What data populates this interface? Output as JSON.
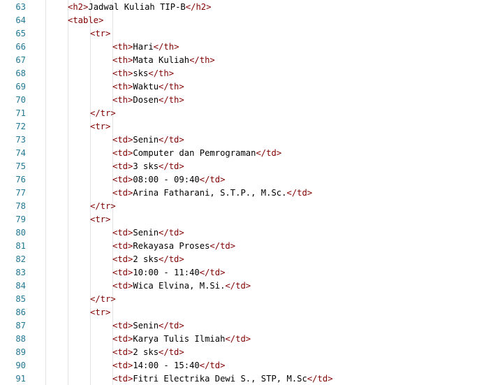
{
  "editor": {
    "colors": {
      "line_number": "#237893",
      "tag": "#800000",
      "text": "#000000",
      "indent_guide": "#e4e4e4"
    },
    "lines": [
      {
        "number": "63",
        "indent": 1,
        "tokens": [
          {
            "t": "tag",
            "v": "<h2>"
          },
          {
            "t": "txt",
            "v": "Jadwal Kuliah TIP-B"
          },
          {
            "t": "tag",
            "v": "</h2>"
          }
        ]
      },
      {
        "number": "64",
        "indent": 1,
        "tokens": [
          {
            "t": "tag",
            "v": "<table>"
          }
        ]
      },
      {
        "number": "65",
        "indent": 2,
        "tokens": [
          {
            "t": "tag",
            "v": "<tr>"
          }
        ]
      },
      {
        "number": "66",
        "indent": 3,
        "tokens": [
          {
            "t": "tag",
            "v": "<th>"
          },
          {
            "t": "txt",
            "v": "Hari"
          },
          {
            "t": "tag",
            "v": "</th>"
          }
        ]
      },
      {
        "number": "67",
        "indent": 3,
        "tokens": [
          {
            "t": "tag",
            "v": "<th>"
          },
          {
            "t": "txt",
            "v": "Mata Kuliah"
          },
          {
            "t": "tag",
            "v": "</th>"
          }
        ]
      },
      {
        "number": "68",
        "indent": 3,
        "tokens": [
          {
            "t": "tag",
            "v": "<th>"
          },
          {
            "t": "txt",
            "v": "sks"
          },
          {
            "t": "tag",
            "v": "</th>"
          }
        ]
      },
      {
        "number": "69",
        "indent": 3,
        "tokens": [
          {
            "t": "tag",
            "v": "<th>"
          },
          {
            "t": "txt",
            "v": "Waktu"
          },
          {
            "t": "tag",
            "v": "</th>"
          }
        ]
      },
      {
        "number": "70",
        "indent": 3,
        "tokens": [
          {
            "t": "tag",
            "v": "<th>"
          },
          {
            "t": "txt",
            "v": "Dosen"
          },
          {
            "t": "tag",
            "v": "</th>"
          }
        ]
      },
      {
        "number": "71",
        "indent": 2,
        "tokens": [
          {
            "t": "tag",
            "v": "</tr>"
          }
        ]
      },
      {
        "number": "72",
        "indent": 2,
        "tokens": [
          {
            "t": "tag",
            "v": "<tr>"
          }
        ]
      },
      {
        "number": "73",
        "indent": 3,
        "tokens": [
          {
            "t": "tag",
            "v": "<td>"
          },
          {
            "t": "txt",
            "v": "Senin"
          },
          {
            "t": "tag",
            "v": "</td>"
          }
        ]
      },
      {
        "number": "74",
        "indent": 3,
        "tokens": [
          {
            "t": "tag",
            "v": "<td>"
          },
          {
            "t": "txt",
            "v": "Computer dan Pemrograman"
          },
          {
            "t": "tag",
            "v": "</td>"
          }
        ]
      },
      {
        "number": "75",
        "indent": 3,
        "tokens": [
          {
            "t": "tag",
            "v": "<td>"
          },
          {
            "t": "txt",
            "v": "3 sks"
          },
          {
            "t": "tag",
            "v": "</td>"
          }
        ]
      },
      {
        "number": "76",
        "indent": 3,
        "tokens": [
          {
            "t": "tag",
            "v": "<td>"
          },
          {
            "t": "txt",
            "v": "08:00 - 09:40"
          },
          {
            "t": "tag",
            "v": "</td>"
          }
        ]
      },
      {
        "number": "77",
        "indent": 3,
        "tokens": [
          {
            "t": "tag",
            "v": "<td>"
          },
          {
            "t": "txt",
            "v": "Arina Fatharani, S.T.P., M.Sc."
          },
          {
            "t": "tag",
            "v": "</td>"
          }
        ]
      },
      {
        "number": "78",
        "indent": 2,
        "tokens": [
          {
            "t": "tag",
            "v": "</tr>"
          }
        ]
      },
      {
        "number": "79",
        "indent": 2,
        "tokens": [
          {
            "t": "tag",
            "v": "<tr>"
          }
        ]
      },
      {
        "number": "80",
        "indent": 3,
        "tokens": [
          {
            "t": "tag",
            "v": "<td>"
          },
          {
            "t": "txt",
            "v": "Senin"
          },
          {
            "t": "tag",
            "v": "</td>"
          }
        ]
      },
      {
        "number": "81",
        "indent": 3,
        "tokens": [
          {
            "t": "tag",
            "v": "<td>"
          },
          {
            "t": "txt",
            "v": "Rekayasa Proses"
          },
          {
            "t": "tag",
            "v": "</td>"
          }
        ]
      },
      {
        "number": "82",
        "indent": 3,
        "tokens": [
          {
            "t": "tag",
            "v": "<td>"
          },
          {
            "t": "txt",
            "v": "2 sks"
          },
          {
            "t": "tag",
            "v": "</td>"
          }
        ]
      },
      {
        "number": "83",
        "indent": 3,
        "tokens": [
          {
            "t": "tag",
            "v": "<td>"
          },
          {
            "t": "txt",
            "v": "10:00 - 11:40"
          },
          {
            "t": "tag",
            "v": "</td>"
          }
        ]
      },
      {
        "number": "84",
        "indent": 3,
        "tokens": [
          {
            "t": "tag",
            "v": "<td>"
          },
          {
            "t": "txt",
            "v": "Wica Elvina, M.Si."
          },
          {
            "t": "tag",
            "v": "</td>"
          }
        ]
      },
      {
        "number": "85",
        "indent": 2,
        "tokens": [
          {
            "t": "tag",
            "v": "</tr>"
          }
        ]
      },
      {
        "number": "86",
        "indent": 2,
        "tokens": [
          {
            "t": "tag",
            "v": "<tr>"
          }
        ]
      },
      {
        "number": "87",
        "indent": 3,
        "tokens": [
          {
            "t": "tag",
            "v": "<td>"
          },
          {
            "t": "txt",
            "v": "Senin"
          },
          {
            "t": "tag",
            "v": "</td>"
          }
        ]
      },
      {
        "number": "88",
        "indent": 3,
        "tokens": [
          {
            "t": "tag",
            "v": "<td>"
          },
          {
            "t": "txt",
            "v": "Karya Tulis Ilmiah"
          },
          {
            "t": "tag",
            "v": "</td>"
          }
        ]
      },
      {
        "number": "89",
        "indent": 3,
        "tokens": [
          {
            "t": "tag",
            "v": "<td>"
          },
          {
            "t": "txt",
            "v": "2 sks"
          },
          {
            "t": "tag",
            "v": "</td>"
          }
        ]
      },
      {
        "number": "90",
        "indent": 3,
        "tokens": [
          {
            "t": "tag",
            "v": "<td>"
          },
          {
            "t": "txt",
            "v": "14:00 - 15:40"
          },
          {
            "t": "tag",
            "v": "</td>"
          }
        ]
      },
      {
        "number": "91",
        "indent": 3,
        "tokens": [
          {
            "t": "tag",
            "v": "<td>"
          },
          {
            "t": "txt",
            "v": "Fitri Electrika Dewi S., STP, M.Sc"
          },
          {
            "t": "tag",
            "v": "</td>"
          }
        ]
      }
    ]
  }
}
